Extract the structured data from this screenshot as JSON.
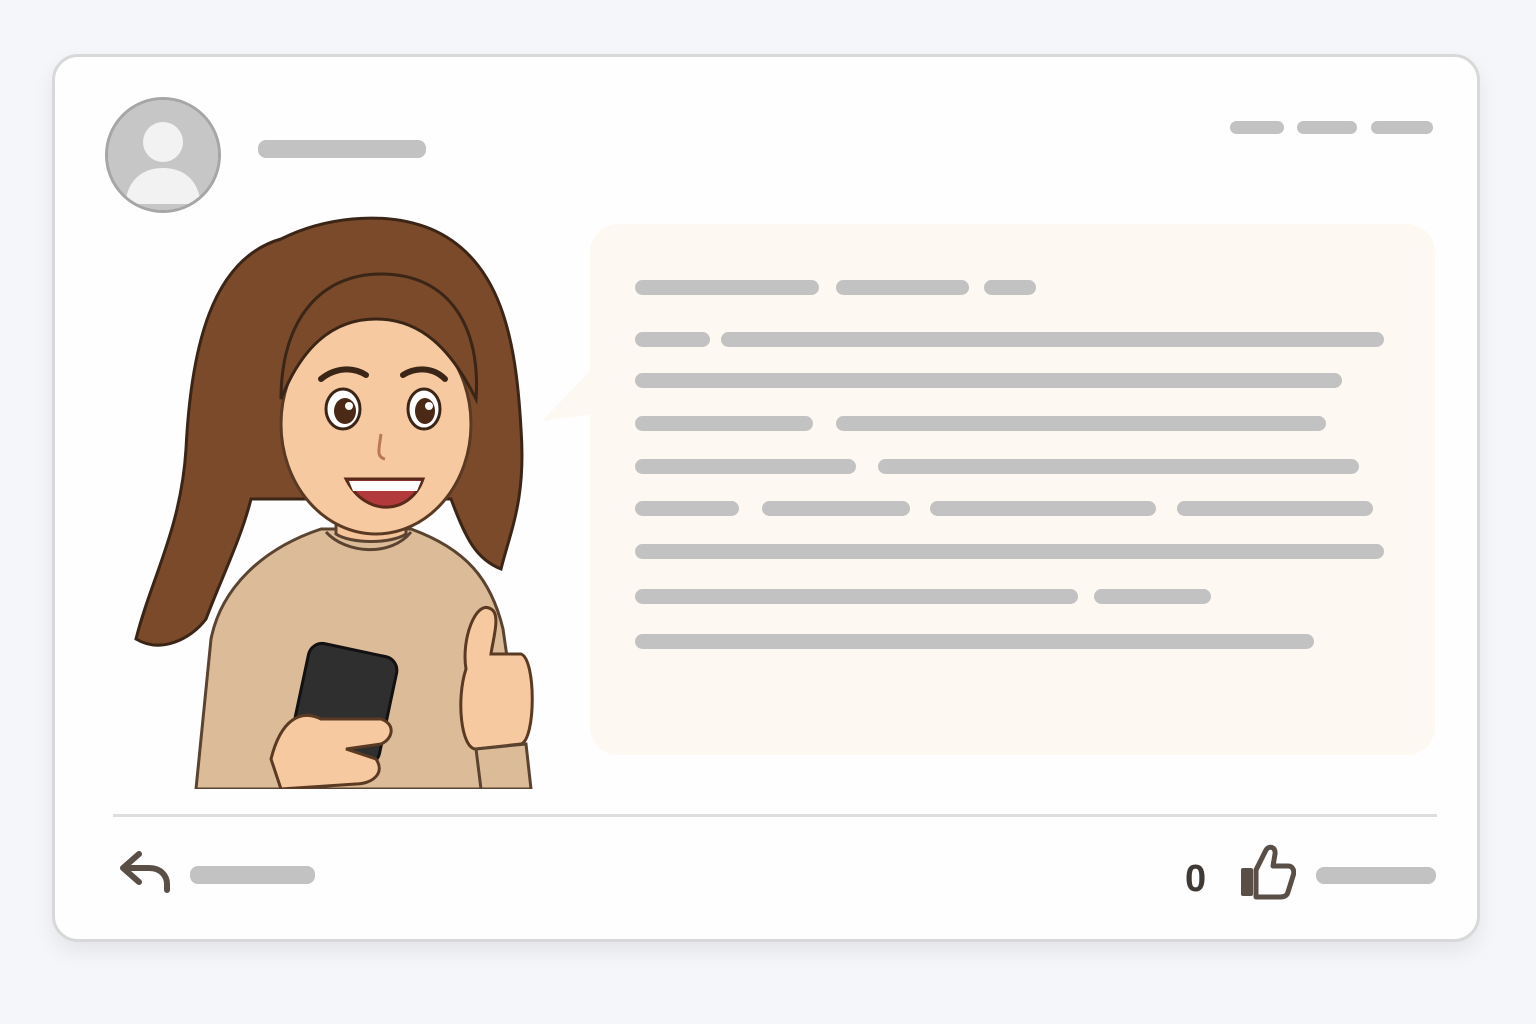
{
  "post": {
    "author": {
      "avatar_icon": "user-avatar-icon",
      "name_placeholder": "author-name-bar"
    },
    "header_menu": [
      "menu-dash",
      "menu-dash",
      "menu-dash"
    ],
    "illustration": "woman-with-phone-thumbs-up",
    "message_bubble": {
      "background": "#fdf8f2",
      "line_count": 8
    },
    "footer": {
      "reply_icon": "reply-arrow-icon",
      "like_count": "0",
      "like_icon": "thumbs-up-icon"
    }
  },
  "colors": {
    "placeholder_bar": "#c2c2c2",
    "card_border": "#d8d8d8",
    "text_dark": "#3f3a36"
  }
}
